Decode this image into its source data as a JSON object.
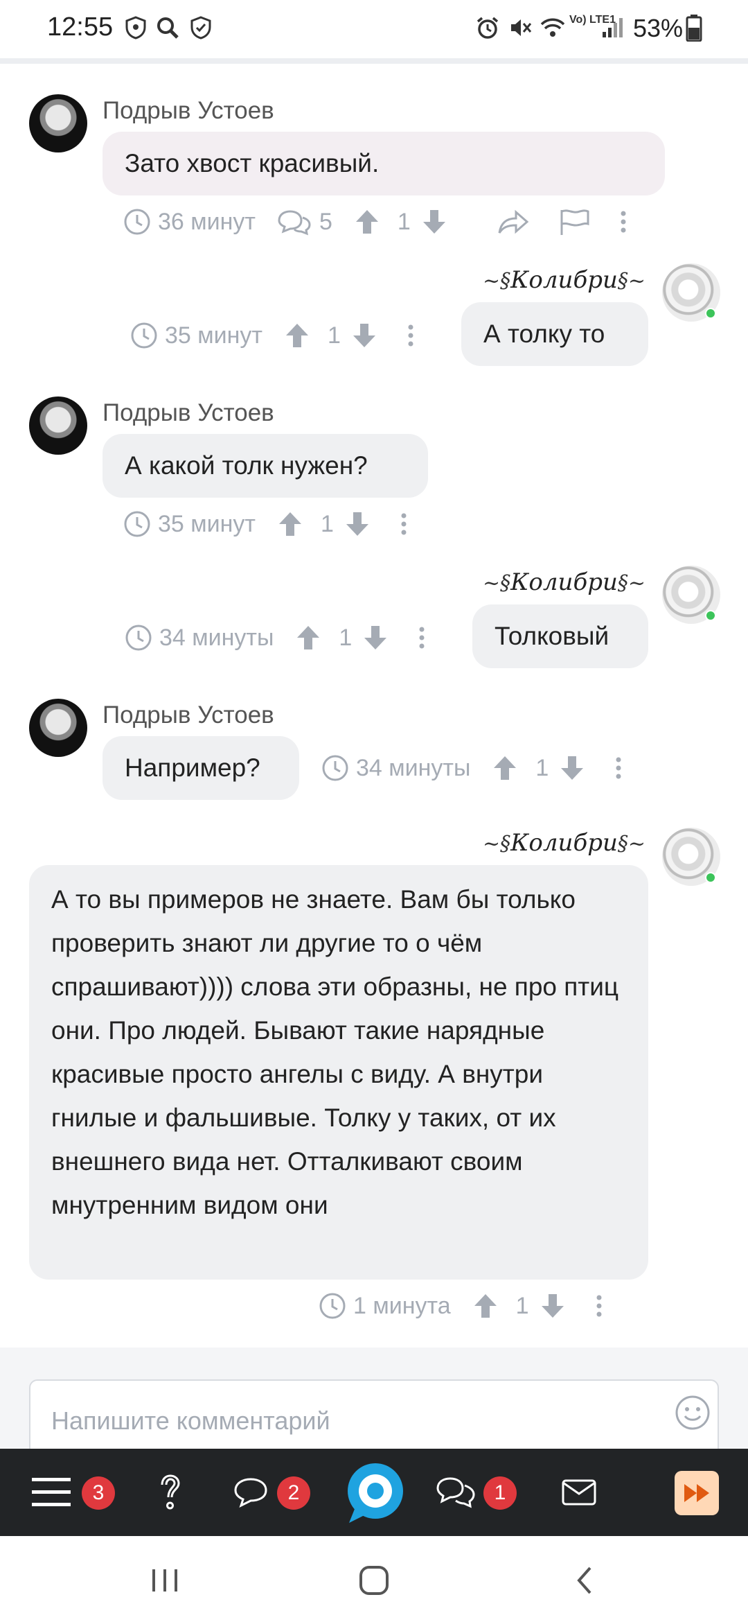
{
  "status_bar": {
    "time": "12:55",
    "battery": "53%",
    "network_label": "Vo) LTE1",
    "icons": [
      "shield-icon",
      "search-icon",
      "shield-check-icon",
      "alarm-icon",
      "mute-icon",
      "wifi-icon",
      "signal-icon",
      "battery-icon"
    ]
  },
  "comments": [
    {
      "author": "Подрыв Устоев",
      "text": "Зато хвост красивый.",
      "time": "36 минут",
      "replies": "5",
      "votes": "1"
    },
    {
      "author": "Колибри",
      "text": "А толку то",
      "time": "35 минут",
      "votes": "1"
    },
    {
      "author": "Подрыв Устоев",
      "text": "А какой толк нужен?",
      "time": "35 минут",
      "votes": "1"
    },
    {
      "author": "Колибри",
      "text": "Толковый",
      "time": "34 минуты",
      "votes": "1"
    },
    {
      "author": "Подрыв Устоев",
      "text": "Например?",
      "time": "34 минуты",
      "votes": "1"
    },
    {
      "author": "Колибри",
      "text": "А то вы примеров не знаете. Вам бы только проверить знают ли другие то о чём спрашивают)))) слова эти образны, не про птиц они. Про людей. Бывают такие нарядные красивые просто ангелы с виду. А внутри гнилые и фальшивые. Толку у таких, от их внешнего вида нет. Отталкивают своим мнутренним видом они",
      "time": "1 минута",
      "votes": "1"
    }
  ],
  "input": {
    "placeholder": "Напишите комментарий"
  },
  "bottom_nav": {
    "menu_badge": "3",
    "chat_badge": "2",
    "comments_badge": "1"
  },
  "colors": {
    "bubble": "#eff0f2",
    "bubble_pink": "#f3eef2",
    "meta": "#a5abb4",
    "nav_bg": "#222426",
    "badge": "#e0393e",
    "brand": "#1fa3e0",
    "online": "#3cc45a"
  }
}
